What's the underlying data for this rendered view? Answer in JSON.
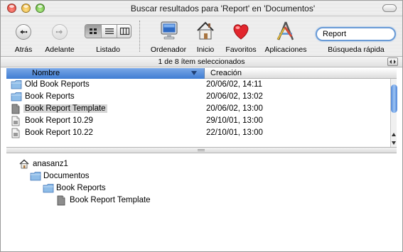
{
  "window": {
    "title": "Buscar resultados para 'Report' en 'Documentos'"
  },
  "toolbar": {
    "back_label": "Atrás",
    "forward_label": "Adelante",
    "view_label": "Listado",
    "computer_label": "Ordenador",
    "home_label": "Inicio",
    "favorites_label": "Favoritos",
    "applications_label": "Aplicaciones",
    "search_label": "Búsqueda rápida",
    "search_value": "Report"
  },
  "status": {
    "text": "1 de 8 ítem seleccionados"
  },
  "columns": {
    "name": "Nombre",
    "date": "Creación"
  },
  "results": [
    {
      "name": "Old Book Reports",
      "date": "20/06/02, 14:11",
      "icon": "folder-icon",
      "selected": false
    },
    {
      "name": "Book Reports",
      "date": "20/06/02, 13:02",
      "icon": "folder-icon",
      "selected": false
    },
    {
      "name": "Book Report Template",
      "date": "20/06/02, 13:00",
      "icon": "template-document-icon",
      "selected": true
    },
    {
      "name": "Book Report 10.29",
      "date": "29/10/01, 13:00",
      "icon": "document-icon",
      "selected": false
    },
    {
      "name": "Book Report 10.22",
      "date": "22/10/01, 13:00",
      "icon": "document-icon",
      "selected": false
    }
  ],
  "path": [
    {
      "name": "anasanz1",
      "icon": "home-icon"
    },
    {
      "name": "Documentos",
      "icon": "folder-icon"
    },
    {
      "name": "Book Reports",
      "icon": "folder-icon"
    },
    {
      "name": "Book Report Template",
      "icon": "template-document-icon"
    }
  ],
  "colors": {
    "selection_header": "#3f7dd3",
    "scroll_thumb": "#4f86d8",
    "search_ring": "#6a9bd6",
    "favorites_heart": "#e2262d"
  }
}
